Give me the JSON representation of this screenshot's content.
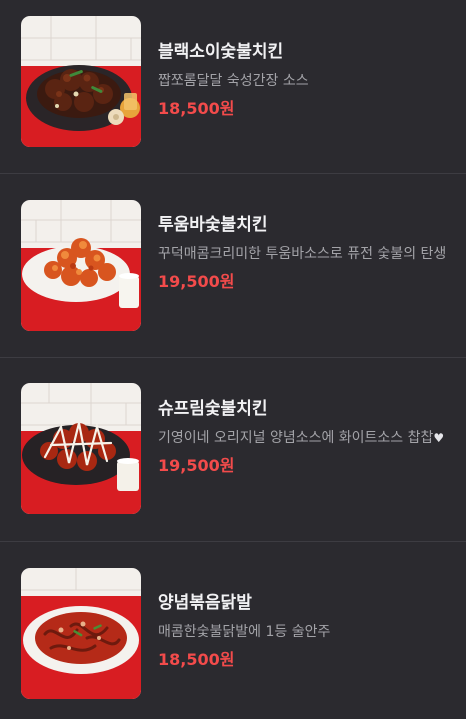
{
  "menu": {
    "items": [
      {
        "name": "블랙소이숯불치킨",
        "description": "짭쪼롬달달 숙성간장 소스",
        "price": "18,500원",
        "image": "chicken-soy-dish-image"
      },
      {
        "name": "투움바숯불치킨",
        "description": "꾸덕매콤크리미한 투움바소스로 퓨전 숯불의 탄생",
        "price": "19,500원",
        "image": "chicken-toowoomba-dish-image"
      },
      {
        "name": "슈프림숯불치킨",
        "description": "기영이네 오리지널 양념소스에 화이트소스 찹찹",
        "description_suffix": "♥",
        "price": "19,500원",
        "image": "chicken-supreme-dish-image"
      },
      {
        "name": "양념볶음닭발",
        "description": "매콤한숯불닭발에 1등 술안주",
        "price": "18,500원",
        "image": "spicy-chicken-feet-dish-image"
      }
    ]
  },
  "colors": {
    "background": "#2b2a2f",
    "price": "#f34b4b",
    "title": "#f2f2f4",
    "description": "#a3a3a8",
    "divider": "#3d3c42"
  }
}
